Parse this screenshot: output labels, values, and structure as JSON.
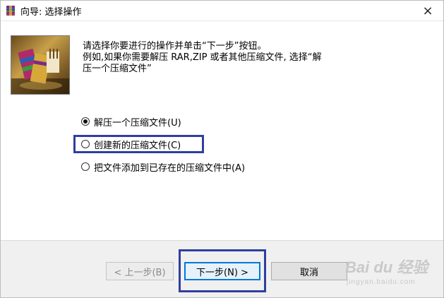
{
  "window": {
    "title": "向导: 选择操作",
    "close_label": "×"
  },
  "instructions": {
    "line1": "请选择你要进行的操作并单击“下一步”按钮。",
    "line2": "例如,如果你需要解压 RAR,ZIP 或者其他压缩文件, 选择“解",
    "line3": "压一个压缩文件”"
  },
  "options": [
    {
      "label": "解压一个压缩文件(U)",
      "checked": true
    },
    {
      "label": "创建新的压缩文件(C)",
      "checked": false
    },
    {
      "label": "把文件添加到已存在的压缩文件中(A)",
      "checked": false
    }
  ],
  "buttons": {
    "back": "< 上一步(B)",
    "next": "下一步(N) >",
    "cancel": "取消"
  },
  "watermark": {
    "brand": "Bai du 经验",
    "sub": "jingyan.baidu.com"
  },
  "colors": {
    "highlight": "#2f3f9e",
    "focus": "#0078d7"
  },
  "icons": {
    "app": "winrar-icon",
    "logo": "winrar-logo-icon",
    "close": "close-icon"
  }
}
